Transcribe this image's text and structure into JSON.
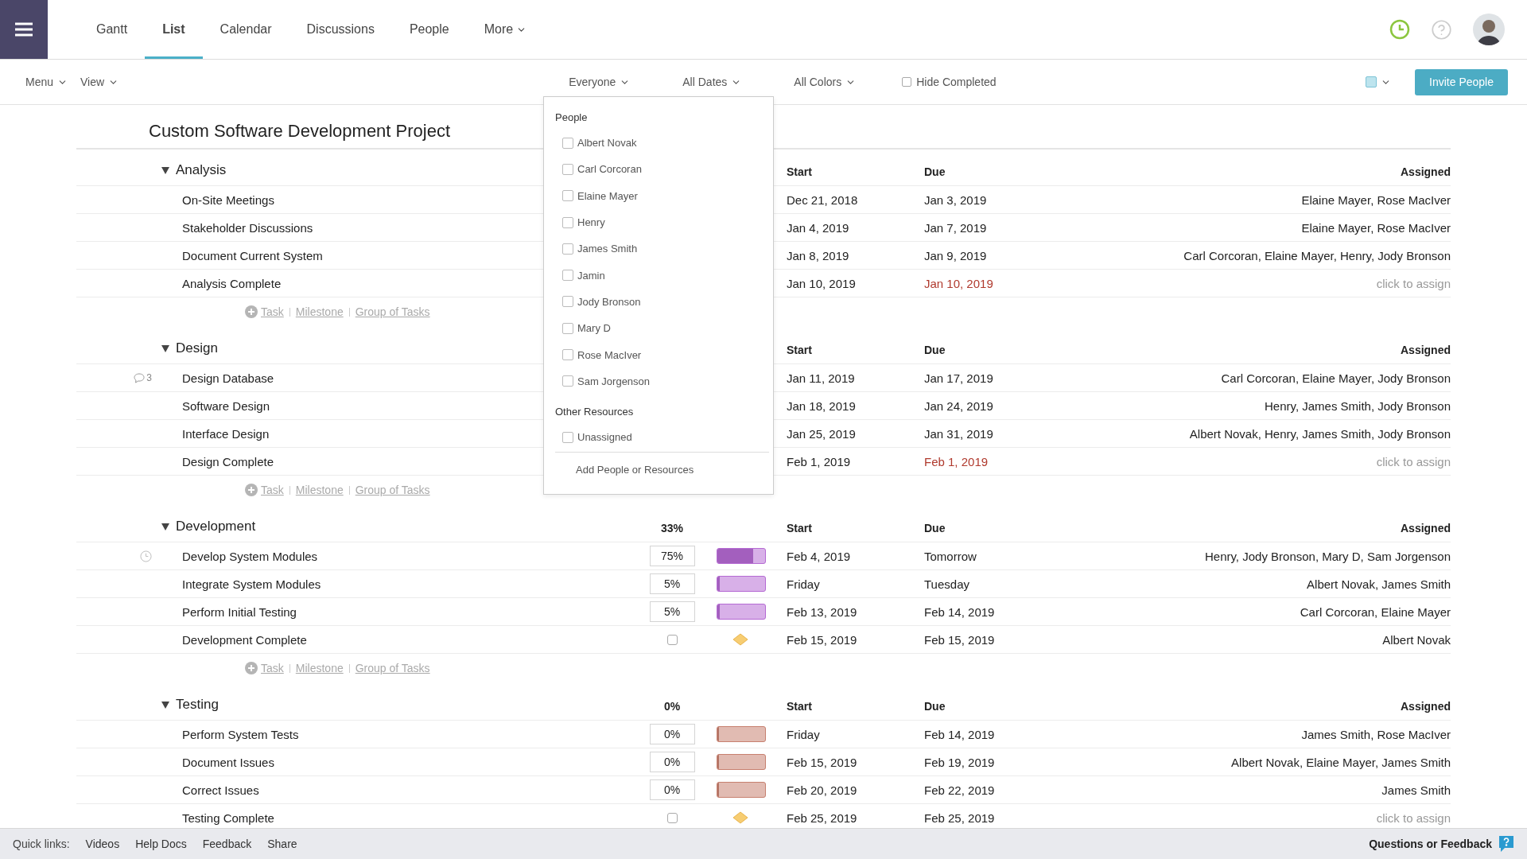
{
  "nav": {
    "tabs": [
      {
        "label": "Gantt",
        "selected": false,
        "menu": false
      },
      {
        "label": "List",
        "selected": true,
        "menu": false
      },
      {
        "label": "Calendar",
        "selected": false,
        "menu": false
      },
      {
        "label": "Discussions",
        "selected": false,
        "menu": false
      },
      {
        "label": "People",
        "selected": false,
        "menu": false
      },
      {
        "label": "More",
        "selected": false,
        "menu": true
      }
    ]
  },
  "toolbar": {
    "left": [
      "Menu",
      "View"
    ],
    "filters": [
      "Everyone",
      "All Dates",
      "All Colors"
    ],
    "hide_completed": {
      "label": "Hide Completed",
      "checked": false
    },
    "invite_button": "Invite People"
  },
  "filter_menu": {
    "sections": [
      {
        "title": "People",
        "items": [
          {
            "label": "Albert Novak",
            "checked": false
          },
          {
            "label": "Carl Corcoran",
            "checked": false
          },
          {
            "label": "Elaine Mayer",
            "checked": false
          },
          {
            "label": "Henry",
            "checked": false
          },
          {
            "label": "James Smith",
            "checked": false
          },
          {
            "label": "Jamin",
            "checked": false
          },
          {
            "label": "Jody Bronson",
            "checked": false
          },
          {
            "label": "Mary D",
            "checked": false
          },
          {
            "label": "Rose MacIver",
            "checked": false
          },
          {
            "label": "Sam Jorgenson",
            "checked": false
          }
        ]
      },
      {
        "title": "Other Resources",
        "items": [
          {
            "label": "Unassigned",
            "checked": false
          }
        ]
      }
    ],
    "action": "Add People or Resources"
  },
  "project_title": "Custom Software Development Project",
  "groups": [
    {
      "name": "Analysis",
      "expanded": true,
      "columns": [
        "Start",
        "Due",
        "Assigned"
      ],
      "add_links": [
        "Task",
        "Milestone",
        "Group of Tasks"
      ],
      "tasks": [
        {
          "kind": "task",
          "name": "On-Site Meetings",
          "start": "Dec 21, 2018",
          "due": "Jan 3, 2019",
          "overdue": false,
          "assigned": "Elaine Mayer, Rose MacIver",
          "unassigned": false
        },
        {
          "kind": "task",
          "name": "Stakeholder Discussions",
          "start": "Jan 4, 2019",
          "due": "Jan 7, 2019",
          "overdue": false,
          "assigned": "Elaine Mayer, Rose MacIver",
          "unassigned": false
        },
        {
          "kind": "task",
          "name": "Document Current System",
          "start": "Jan 8, 2019",
          "due": "Jan 9, 2019",
          "overdue": false,
          "assigned": "Carl Corcoran, Elaine Mayer, Henry, Jody Bronson",
          "unassigned": false
        },
        {
          "kind": "milestone",
          "name": "Analysis Complete",
          "start": "Jan 10, 2019",
          "due": "Jan 10, 2019",
          "overdue": true,
          "assigned": "click to assign",
          "unassigned": true
        }
      ]
    },
    {
      "name": "Design",
      "expanded": true,
      "columns": [
        "Start",
        "Due",
        "Assigned"
      ],
      "add_links": [
        "Task",
        "Milestone",
        "Group of Tasks"
      ],
      "tasks": [
        {
          "kind": "task",
          "name": "Design Database",
          "flag": {
            "kind": "comments",
            "count": "3"
          },
          "start": "Jan 11, 2019",
          "due": "Jan 17, 2019",
          "overdue": false,
          "assigned": "Carl Corcoran, Elaine Mayer, Jody Bronson",
          "unassigned": false
        },
        {
          "kind": "task",
          "name": "Software Design",
          "start": "Jan 18, 2019",
          "due": "Jan 24, 2019",
          "overdue": false,
          "assigned": "Henry, James Smith, Jody Bronson",
          "unassigned": false
        },
        {
          "kind": "task",
          "name": "Interface Design",
          "start": "Jan 25, 2019",
          "due": "Jan 31, 2019",
          "overdue": false,
          "assigned": "Albert Novak, Henry, James Smith, Jody Bronson",
          "unassigned": false
        },
        {
          "kind": "milestone",
          "name": "Design Complete",
          "start": "Feb 1, 2019",
          "due": "Feb 1, 2019",
          "overdue": true,
          "assigned": "click to assign",
          "unassigned": true
        }
      ]
    },
    {
      "name": "Development",
      "expanded": true,
      "percent": "33%",
      "color": "#b56ad3",
      "columns": [
        "Start",
        "Due",
        "Assigned"
      ],
      "add_links": [
        "Task",
        "Milestone",
        "Group of Tasks"
      ],
      "tasks": [
        {
          "kind": "task",
          "name": "Develop System Modules",
          "flag": {
            "kind": "clock"
          },
          "percent": "75%",
          "level": 0.75,
          "start": "Feb 4, 2019",
          "due": "Tomorrow",
          "overdue": false,
          "assigned": "Henry, Jody Bronson, Mary D, Sam Jorgenson",
          "unassigned": false
        },
        {
          "kind": "task",
          "name": "Integrate System Modules",
          "percent": "5%",
          "level": 0.05,
          "start": "Friday",
          "due": "Tuesday",
          "overdue": false,
          "assigned": "Albert Novak, James Smith",
          "unassigned": false
        },
        {
          "kind": "task",
          "name": "Perform Initial Testing",
          "percent": "5%",
          "level": 0.05,
          "start": "Feb 13, 2019",
          "due": "Feb 14, 2019",
          "overdue": false,
          "assigned": "Carl Corcoran, Elaine Mayer",
          "unassigned": false
        },
        {
          "kind": "milestone",
          "name": "Development Complete",
          "checked": false,
          "start": "Feb 15, 2019",
          "due": "Feb 15, 2019",
          "overdue": false,
          "assigned": "Albert Novak",
          "unassigned": false
        }
      ]
    },
    {
      "name": "Testing",
      "expanded": true,
      "percent": "0%",
      "color": "#c7806f",
      "columns": [
        "Start",
        "Due",
        "Assigned"
      ],
      "tasks": [
        {
          "kind": "task",
          "name": "Perform System Tests",
          "percent": "0%",
          "level": 0,
          "start": "Friday",
          "due": "Feb 14, 2019",
          "overdue": false,
          "assigned": "James Smith, Rose MacIver",
          "unassigned": false
        },
        {
          "kind": "task",
          "name": "Document Issues",
          "percent": "0%",
          "level": 0,
          "start": "Feb 15, 2019",
          "due": "Feb 19, 2019",
          "overdue": false,
          "assigned": "Albert Novak, Elaine Mayer, James Smith",
          "unassigned": false
        },
        {
          "kind": "task",
          "name": "Correct Issues",
          "percent": "0%",
          "level": 0,
          "start": "Feb 20, 2019",
          "due": "Feb 22, 2019",
          "overdue": false,
          "assigned": "James Smith",
          "unassigned": false
        },
        {
          "kind": "milestone",
          "name": "Testing Complete",
          "checked": false,
          "start": "Feb 25, 2019",
          "due": "Feb 25, 2019",
          "overdue": false,
          "assigned": "click to assign",
          "unassigned": true
        }
      ]
    }
  ],
  "footer": {
    "label": "Quick links:",
    "links": [
      "Videos",
      "Help Docs",
      "Feedback",
      "Share"
    ],
    "feedback": "Questions or Feedback"
  }
}
